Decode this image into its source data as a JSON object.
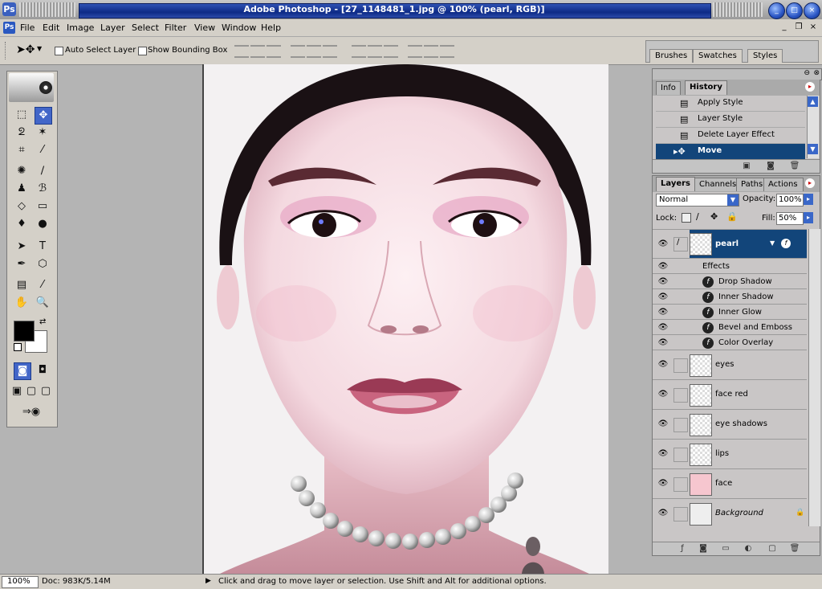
{
  "window": {
    "title": "Adobe Photoshop - [27_1148481_1.jpg @ 100% (pearl, RGB)]"
  },
  "menu": [
    "File",
    "Edit",
    "Image",
    "Layer",
    "Select",
    "Filter",
    "View",
    "Window",
    "Help"
  ],
  "options": {
    "auto_select": "Auto Select Layer",
    "bounding_box": "Show Bounding Box"
  },
  "well_tabs": [
    "Brushes",
    "Swatches",
    "Styles"
  ],
  "history_panel": {
    "tabs": [
      "Info",
      "History"
    ],
    "items": [
      "Apply Style",
      "Layer Style",
      "Delete Layer Effect",
      "Move"
    ]
  },
  "layers_panel": {
    "tabs": [
      "Layers",
      "Channels",
      "Paths",
      "Actions"
    ],
    "blend_mode": "Normal",
    "opacity_label": "Opacity:",
    "opacity": "100%",
    "lock_label": "Lock:",
    "fill_label": "Fill:",
    "fill": "50%",
    "effects_label": "Effects",
    "active_layer": "pearl",
    "effects": [
      "Drop Shadow",
      "Inner Shadow",
      "Inner Glow",
      "Bevel and Emboss",
      "Color Overlay"
    ],
    "layers": [
      "eyes",
      "face red",
      "eye shadows",
      "lips",
      "face",
      "Background"
    ]
  },
  "status": {
    "zoom": "100%",
    "doc": "Doc: 983K/5.14M",
    "hint": "Click and drag to move layer or selection.  Use Shift and Alt for additional options."
  },
  "colors": {
    "title_blue": "#0d2a86",
    "selection_blue": "#12457a",
    "panel_gray": "#c9c6c6"
  }
}
